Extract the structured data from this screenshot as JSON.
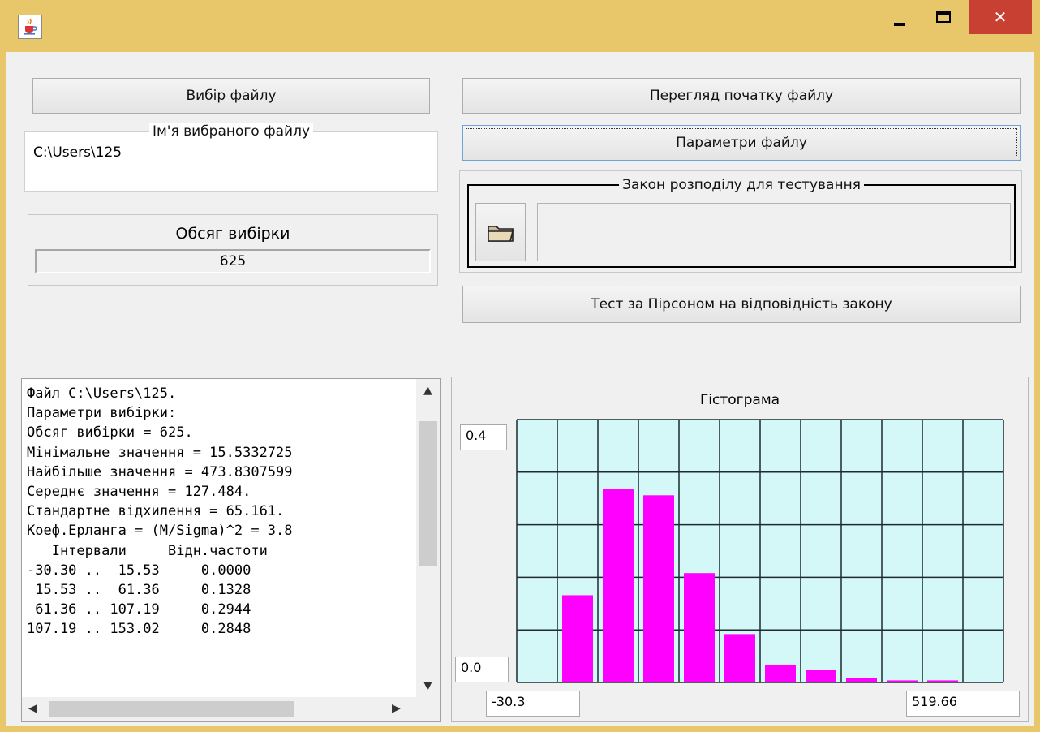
{
  "window": {
    "close_symbol": "✕",
    "icon": "java-coffee-icon"
  },
  "left": {
    "choose_file_label": "Вибір файлу",
    "selected_file_legend": "Ім'я вибраного файлу",
    "selected_file_path": "C:\\Users\\125",
    "sample_size_title": "Обсяг вибірки",
    "sample_size_value": "625"
  },
  "right": {
    "view_start_label": "Перегляд початку файлу",
    "file_params_label": "Параметри файлу",
    "distribution_legend": "Закон розподілу для тестування",
    "distribution_value": "",
    "pearson_test_label": "Тест за Пірсоном на відповідність закону"
  },
  "output": {
    "lines": [
      "Файл C:\\Users\\125.",
      "Параметри вибірки:",
      "Обсяг вибірки = 625.",
      "Мінімальне значення = 15.5332725",
      "Найбільше значення = 473.8307599",
      "Середнє значення = 127.484.",
      "Стандартне відхилення = 65.161.",
      "Коеф.Ерланга = (M/Sigma)^2 = 3.8",
      "   Інтервали     Відн.частоти",
      "-30.30 ..  15.53     0.0000",
      " 15.53 ..  61.36     0.1328",
      " 61.36 .. 107.19     0.2944",
      "107.19 .. 153.02     0.2848"
    ]
  },
  "chart_data": {
    "type": "bar",
    "title": "Гістограма",
    "y_max_label": "0.4",
    "y_min_label": "0.0",
    "x_min_label": "-30.3",
    "x_max_label": "519.66",
    "ylim": [
      0,
      0.4
    ],
    "xlim": [
      -30.3,
      519.66
    ],
    "grid": true,
    "bar_color": "#ff00ff",
    "plot_bg": "#d4f7f7",
    "bins": [
      {
        "from": -30.3,
        "to": 15.53,
        "value": 0.0
      },
      {
        "from": 15.53,
        "to": 61.36,
        "value": 0.1328
      },
      {
        "from": 61.36,
        "to": 107.19,
        "value": 0.2944
      },
      {
        "from": 107.19,
        "to": 153.02,
        "value": 0.2848
      },
      {
        "from": 153.02,
        "to": 198.85,
        "value": 0.1664
      },
      {
        "from": 198.85,
        "to": 244.68,
        "value": 0.0736
      },
      {
        "from": 244.68,
        "to": 290.51,
        "value": 0.0272
      },
      {
        "from": 290.51,
        "to": 336.34,
        "value": 0.0192
      },
      {
        "from": 336.34,
        "to": 382.17,
        "value": 0.0064
      },
      {
        "from": 382.17,
        "to": 428.0,
        "value": 0.0032
      },
      {
        "from": 428.0,
        "to": 473.83,
        "value": 0.0032
      }
    ]
  }
}
